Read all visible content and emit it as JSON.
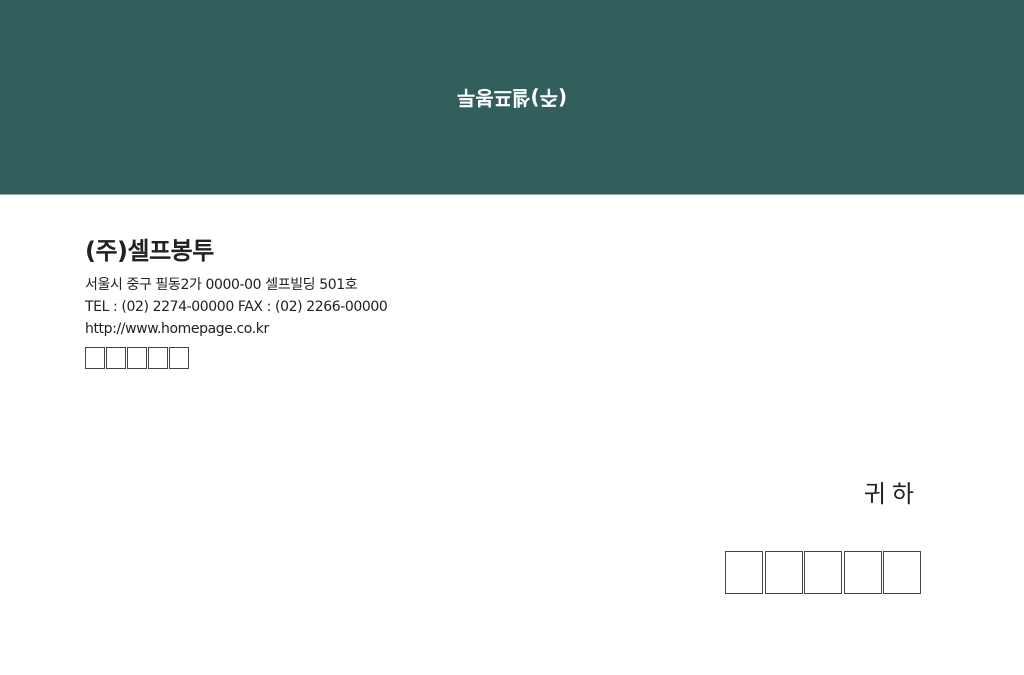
{
  "colors": {
    "flap_background": "#325e5b",
    "flap_text": "#ffffff"
  },
  "flap": {
    "text_upside_down": "(주)셀프봉투"
  },
  "sender": {
    "company": "(주)셀프봉투",
    "address": "서울시 중구 필동2가 0000-00 셀프빌딩 501호",
    "phone_fax": "TEL : (02) 2274-00000  FAX : (02) 2266-00000",
    "website": "http://www.homepage.co.kr",
    "postal_box_count": 5
  },
  "recipient": {
    "honorific": "귀하",
    "postal_box_count": 5
  }
}
